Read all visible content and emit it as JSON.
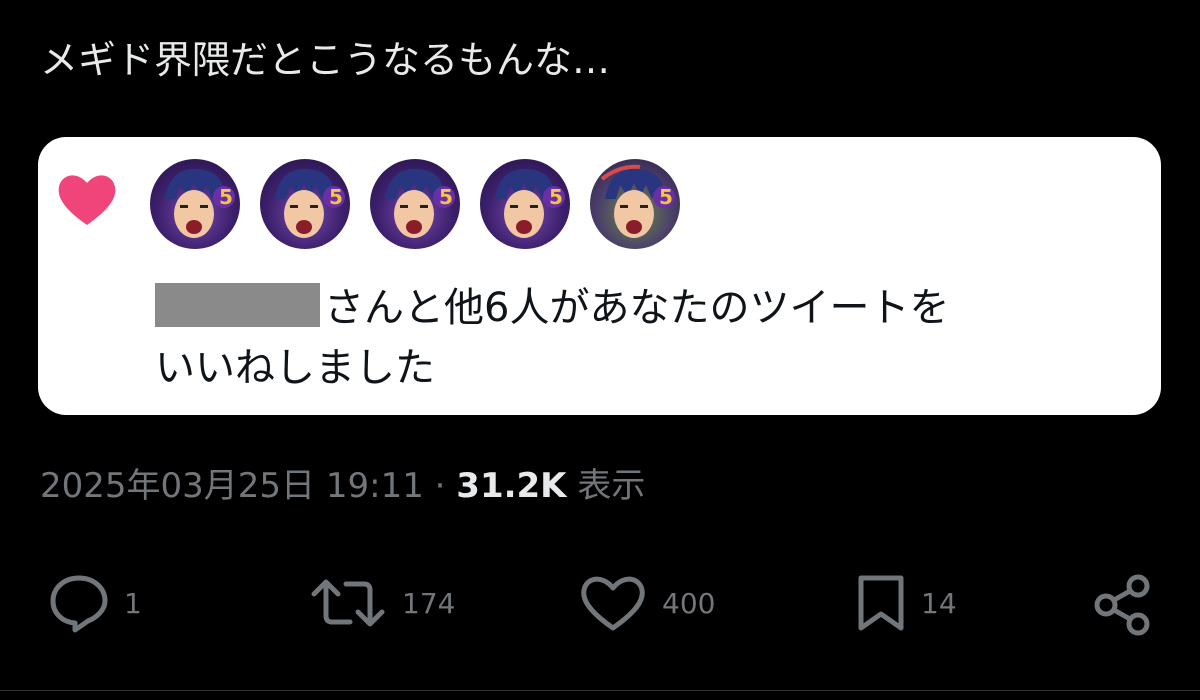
{
  "tweet": {
    "text": "メギド界隈だとこうなるもんな…"
  },
  "embed": {
    "notification_text": "さんと他6人があなたのツイートを",
    "notification_text_line2": "いいねしました",
    "heart_color": "#f0457a",
    "avatar_count": 5
  },
  "meta": {
    "timestamp": "2025年03月25日 19:11",
    "separator": "·",
    "views_count": "31.2K",
    "views_label": "表示"
  },
  "actions": {
    "reply_count": "1",
    "retweet_count": "174",
    "like_count": "400",
    "bookmark_count": "14"
  },
  "icons": {
    "reply": "reply-icon",
    "retweet": "retweet-icon",
    "like": "heart-icon",
    "bookmark": "bookmark-icon",
    "share": "share-icon"
  }
}
